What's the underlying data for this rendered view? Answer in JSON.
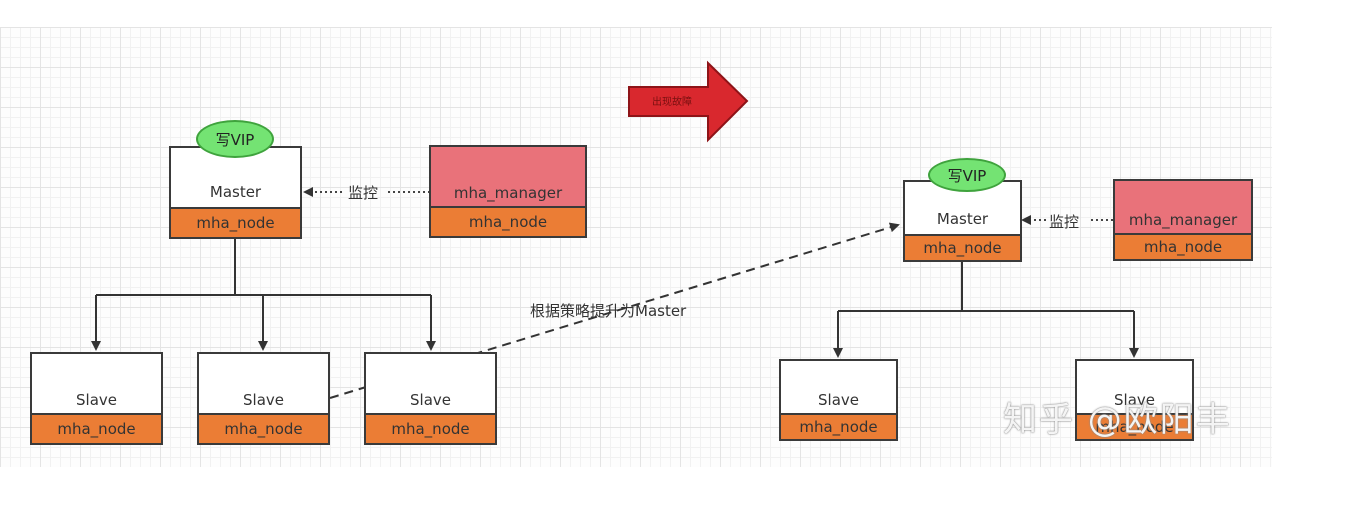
{
  "left": {
    "vip_label": "写VIP",
    "master": {
      "title": "Master",
      "node": "mha_node"
    },
    "manager": {
      "title": "mha_manager",
      "node": "mha_node"
    },
    "monitor_label": "监控",
    "slaves": [
      {
        "title": "Slave",
        "node": "mha_node"
      },
      {
        "title": "Slave",
        "node": "mha_node"
      },
      {
        "title": "Slave",
        "node": "mha_node"
      }
    ]
  },
  "failover_arrow_label": "出现故障",
  "promote_label": "根据策略提升为Master",
  "right": {
    "vip_label": "写VIP",
    "master": {
      "title": "Master",
      "node": "mha_node"
    },
    "manager": {
      "title": "mha_manager",
      "node": "mha_node"
    },
    "monitor_label": "监控",
    "slaves": [
      {
        "title": "Slave",
        "node": "mha_node"
      },
      {
        "title": "Slave",
        "node": "mha_node"
      }
    ]
  },
  "watermark": "知乎 @欧阳丰",
  "colors": {
    "node_bar": "#eb7d35",
    "manager_fill": "#e9727a",
    "vip_fill": "#74e373",
    "failover_arrow": "#d9282e"
  }
}
